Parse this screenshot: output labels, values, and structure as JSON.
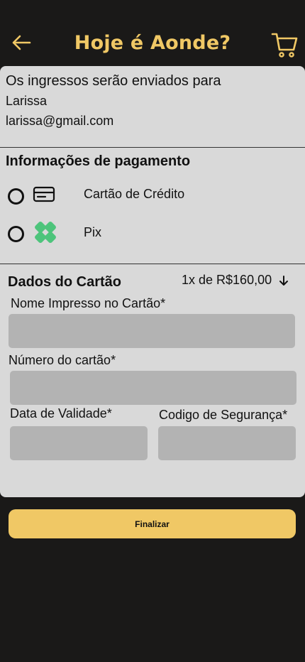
{
  "header": {
    "title": "Hoje é Aonde?",
    "back_icon": "arrow-left-icon",
    "cart_icon": "shopping-cart-icon",
    "accent_color": "#f0c865"
  },
  "recipient": {
    "heading": "Os ingressos serão enviados para",
    "name": "Larissa",
    "email": "larissa@gmail.com"
  },
  "payment": {
    "heading": "Informações de pagamento",
    "options": [
      {
        "label": "Cartão de Crédito",
        "icon": "credit-card-icon",
        "selected": false
      },
      {
        "label": "Pix",
        "icon": "pix-icon",
        "selected": false
      }
    ]
  },
  "card_details": {
    "heading": "Dados do Cartão",
    "installments": "1x de R$160,00",
    "installments_icon": "arrow-down-icon",
    "fields": {
      "name_label": "Nome Impresso no Cartão*",
      "name_value": "",
      "number_label": "Número do cartão*",
      "number_value": "",
      "expiry_label": "Data de Validade*",
      "expiry_value": "",
      "cvv_label": "Codigo de Segurança*",
      "cvv_value": ""
    }
  },
  "actions": {
    "finalize_label": "Finalizar"
  }
}
